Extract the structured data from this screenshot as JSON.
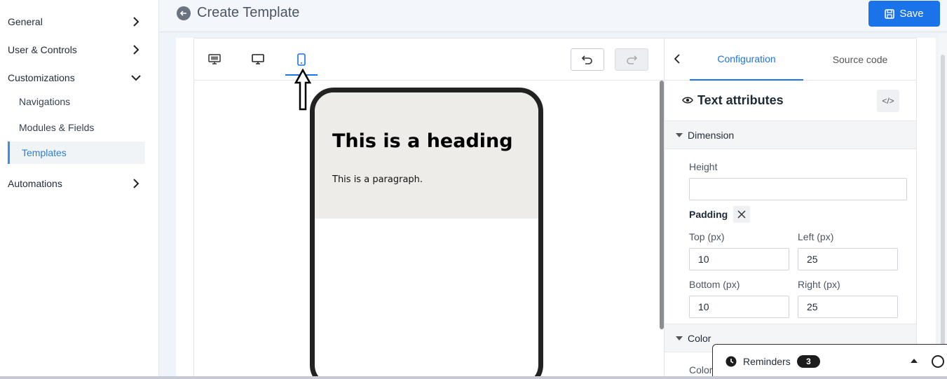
{
  "sidebar": {
    "items": [
      {
        "label": "General",
        "icon": "chevron-right-icon"
      },
      {
        "label": "User & Controls",
        "icon": "chevron-right-icon"
      },
      {
        "label": "Customizations",
        "icon": "chevron-down-icon"
      },
      {
        "label": "Automations",
        "icon": "chevron-right-icon"
      }
    ],
    "sub_items": [
      {
        "label": "Navigations",
        "active": false
      },
      {
        "label": "Modules & Fields",
        "active": false
      },
      {
        "label": "Templates",
        "active": true
      }
    ]
  },
  "header": {
    "title": "Create Template",
    "save_label": "Save"
  },
  "toolbar": {
    "devices": [
      "desktop-preview-icon",
      "monitor-icon",
      "mobile-icon"
    ],
    "active_device": "mobile-icon"
  },
  "preview": {
    "heading": "This is a heading",
    "paragraph": "This is a paragraph."
  },
  "panel": {
    "tabs": [
      {
        "label": "Configuration",
        "active": true
      },
      {
        "label": "Source code",
        "active": false
      }
    ],
    "section_title": "Text attributes",
    "groups": {
      "dimension": "Dimension",
      "color": "Color"
    },
    "height_label": "Height",
    "height_value": "",
    "padding_label": "Padding",
    "padding": {
      "top_label": "Top (px)",
      "top_value": "10",
      "left_label": "Left (px)",
      "left_value": "25",
      "bottom_label": "Bottom (px)",
      "bottom_value": "10",
      "right_label": "Right (px)",
      "right_value": "25"
    },
    "color_field_label": "Color"
  },
  "reminders": {
    "label": "Reminders",
    "count": "3"
  },
  "colors": {
    "accent": "#1a73e8",
    "active_nav": "#2b7fd6"
  }
}
